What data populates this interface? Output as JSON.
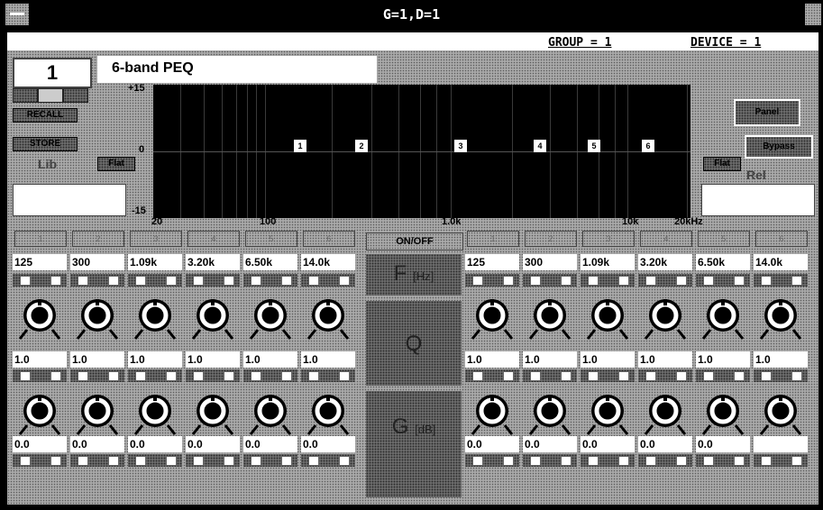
{
  "window": {
    "title": "G=1,D=1"
  },
  "status": {
    "group": "GROUP = 1",
    "device": "DEVICE = 1"
  },
  "preset": {
    "number": "1",
    "name": "6-band PEQ",
    "recall_label": "RECALL",
    "store_label": "STORE",
    "lib_label": "Lib"
  },
  "graph": {
    "y_top": "+15",
    "y_mid": "0",
    "y_bottom": "-15",
    "x_labels": [
      "20",
      "100",
      "1.0k",
      "10k",
      "20kHz"
    ],
    "markers": [
      "1",
      "2",
      "3",
      "4",
      "5",
      "6"
    ]
  },
  "right_panel": {
    "btn_a": "Panel",
    "btn_b": "Bypass",
    "rel_label": "Rel",
    "flat_label": "Flat"
  },
  "center": {
    "header": "ON/OFF",
    "f_label": "F",
    "f_unit": "[Hz]",
    "q_label": "Q",
    "g_label": "G",
    "g_unit": "[dB]"
  },
  "left_channels": [
    {
      "num": "1",
      "freq": "125",
      "q": "1.0",
      "gain": "0.0"
    },
    {
      "num": "2",
      "freq": "300",
      "q": "1.0",
      "gain": "0.0"
    },
    {
      "num": "3",
      "freq": "1.09k",
      "q": "1.0",
      "gain": "0.0"
    },
    {
      "num": "4",
      "freq": "3.20k",
      "q": "1.0",
      "gain": "0.0"
    },
    {
      "num": "5",
      "freq": "6.50k",
      "q": "1.0",
      "gain": "0.0"
    },
    {
      "num": "6",
      "freq": "14.0k",
      "q": "1.0",
      "gain": "0.0"
    }
  ],
  "right_channels": [
    {
      "num": "1",
      "freq": "125",
      "q": "1.0",
      "gain": "0.0"
    },
    {
      "num": "2",
      "freq": "300",
      "q": "1.0",
      "gain": "0.0"
    },
    {
      "num": "3",
      "freq": "1.09k",
      "q": "1.0",
      "gain": "0.0"
    },
    {
      "num": "4",
      "freq": "3.20k",
      "q": "1.0",
      "gain": "0.0"
    },
    {
      "num": "5",
      "freq": "6.50k",
      "q": "1.0",
      "gain": "0.0"
    },
    {
      "num": "6",
      "freq": "14.0k",
      "q": "1.0",
      "gain": ""
    }
  ]
}
